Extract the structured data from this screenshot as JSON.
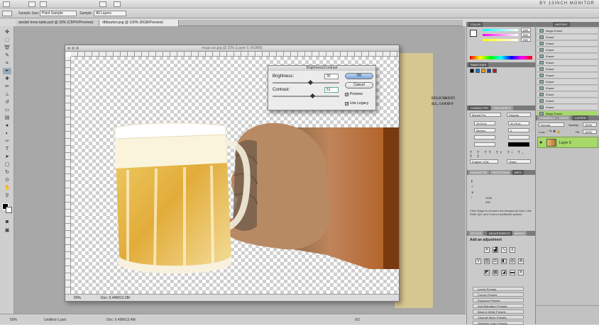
{
  "app": {
    "workspace": "BY 13INCH MONITOR"
  },
  "options_bar": {
    "sample_size_label": "Sample Size:",
    "sample_size_value": "Point Sample",
    "sample_label": "Sample:",
    "sample_value": "All Layers"
  },
  "tabs": [
    {
      "label": "amdah brew table.psd @ 33% (CMYK/Preview)"
    },
    {
      "label": "r8bbarker.psg @ 100% (RGB/Preview)"
    }
  ],
  "document": {
    "title": "mugs-uci.jpg @ 33% (Layer 0, RGB/8)",
    "zoom": "50%",
    "doc_info": "Doc: 5.49M/13.3M",
    "background_text": [
      "EFLICHKEIT!",
      "ILL, GOOD-F"
    ]
  },
  "dialog": {
    "title": "Brightness/Contrast",
    "brightness_label": "Brightness:",
    "brightness_value": "30",
    "contrast_label": "Contrast:",
    "contrast_value": "51",
    "ok_label": "OK",
    "cancel_label": "Cancel",
    "preview_label": "Preview",
    "use_legacy_label": "Use Legacy",
    "preview_checked": true,
    "use_legacy_checked": true,
    "brightness_level": 0.56,
    "contrast_level": 0.6
  },
  "panels": {
    "color_tab": "COLOR",
    "swatches_tab": "SWATCHES",
    "character_tab": "CHARACTER",
    "paragraph_tab": "PARAGRAPH",
    "navigator_tab": "NAVIGATOR",
    "histogram_tab": "HISTOGRAM",
    "info_tab": "INFO",
    "styles_tab": "STYLES",
    "adjustments_tab": "ADJUSTMENTS",
    "masks_tab": "MASKS",
    "color_values": [
      "255",
      "255",
      "255"
    ],
    "font_family": "Myriad Pro",
    "font_style": "Regular",
    "font_size": "15.00 pt",
    "leading": "32.29 pt",
    "tracking": "0",
    "kerning": "Metrics",
    "language": "English: USA",
    "antialias": "Sharp",
    "info_text": "Click image to choose new foreground color. Use Shift, Opt, and Cmd for additional options.",
    "info_values": [
      "1226",
      "200"
    ],
    "adjustments_heading": "Add an adjustment",
    "presets": [
      "Levels Presets",
      "Curves Presets",
      "Exposure Presets",
      "Hue/Saturation Presets",
      "Black & White Presets",
      "Channel Mixer Presets",
      "Selective Color Presets"
    ],
    "history_tab": "HISTORY",
    "history_items": [
      "Magic Eraser",
      "Eraser",
      "Eraser",
      "Eraser",
      "Eraser",
      "Eraser",
      "Eraser",
      "Eraser",
      "Eraser",
      "Eraser",
      "Eraser",
      "Eraser",
      "Eraser",
      "Magic Eraser"
    ],
    "history_selected_index": 13,
    "channels_tab": "CHANNELS",
    "paths_tab": "PATHS",
    "layers_tab": "LAYERS",
    "blend_mode": "Normal",
    "opacity_label": "Opacity:",
    "opacity_value": "100%",
    "lock_label": "Lock:",
    "fill_label": "Fill:",
    "fill_value": "100%",
    "layer_name": "Layer 0"
  },
  "status": {
    "zoom": "50%",
    "doc_info": "Doc: 5.49M/13.3M",
    "doc_info_bottom": "Doc: 5.49M/13.4M",
    "untitled": "Untitled-1.psd",
    "page_ref": "0/2"
  },
  "colors": {
    "accent_green": "#a6d86a",
    "ok_button": "#7ea7db",
    "beer": "#e8b84a",
    "skin": "#b8733a"
  }
}
